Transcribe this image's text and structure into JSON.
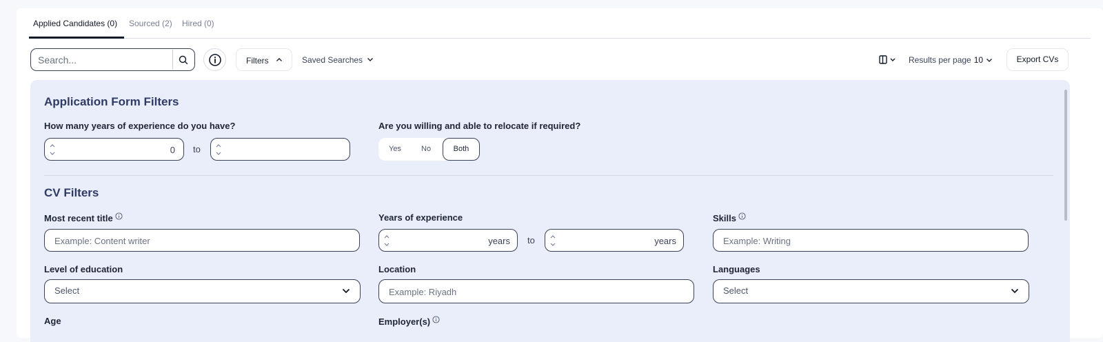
{
  "tabs": [
    {
      "label": "Applied Candidates (0)",
      "active": true
    },
    {
      "label": "Sourced (2)",
      "active": false
    },
    {
      "label": "Hired (0)",
      "active": false
    }
  ],
  "toolbar": {
    "search_placeholder": "Search...",
    "filters_label": "Filters",
    "saved_searches_label": "Saved Searches",
    "results_per_page_label": "Results per page",
    "results_per_page_value": "10",
    "export_label": "Export CVs"
  },
  "application_form": {
    "title": "Application Form Filters",
    "experience_question": "How many years of experience do you have?",
    "experience_from": "0",
    "to_label": "to",
    "relocate_question": "Are you willing and able to relocate if required?",
    "relocate_options": [
      "Yes",
      "No",
      "Both"
    ],
    "relocate_selected": "Both"
  },
  "cv_filters": {
    "title": "CV Filters",
    "most_recent_title_label": "Most recent title",
    "most_recent_title_placeholder": "Example: Content writer",
    "years_experience_label": "Years of experience",
    "years_suffix": "years",
    "to_label": "to",
    "skills_label": "Skills",
    "skills_placeholder": "Example: Writing",
    "education_label": "Level of education",
    "education_value": "Select",
    "location_label": "Location",
    "location_placeholder": "Example: Riyadh",
    "languages_label": "Languages",
    "languages_value": "Select",
    "age_label": "Age",
    "employers_label": "Employer(s)"
  },
  "colors": {
    "panel_bg": "#eaeefb",
    "section_title": "#2f3b63",
    "border": "#3a4256"
  }
}
